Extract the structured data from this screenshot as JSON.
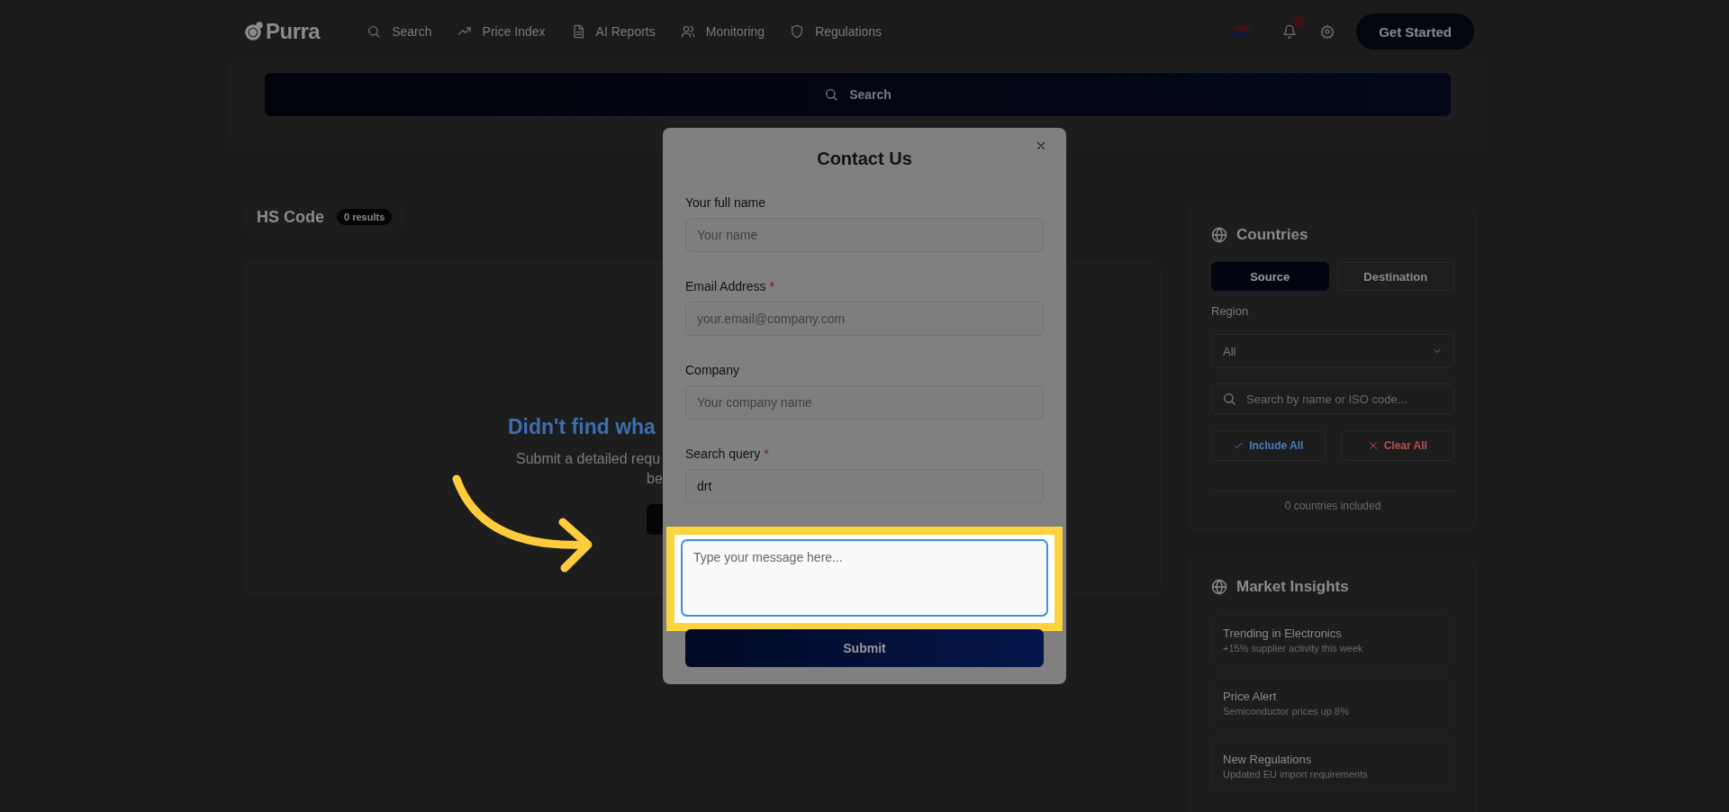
{
  "nav": {
    "logo": "Purra",
    "items": [
      {
        "kind": "search",
        "label": "Search"
      },
      {
        "kind": "trend",
        "label": "Price Index"
      },
      {
        "kind": "doc",
        "label": "AI Reports"
      },
      {
        "kind": "users",
        "label": "Monitoring"
      },
      {
        "kind": "shield",
        "label": "Regulations"
      }
    ],
    "cta": "Get Started"
  },
  "search_bar": {
    "label": "Search"
  },
  "hs_panel": {
    "title": "HS Code",
    "badge": "0 results"
  },
  "empty_state": {
    "heading": "Didn't find wha",
    "text": "Submit a detailed requ",
    "text_2": "be"
  },
  "countries": {
    "title": "Countries",
    "tabs": [
      {
        "label": "Source",
        "selected": true
      },
      {
        "label": "Destination",
        "selected": false
      }
    ],
    "region_label": "Region",
    "region_value": "All",
    "search_placeholder": "Search by name or ISO code...",
    "include_all": "Include All",
    "clear_all": "Clear All",
    "count": "0 countries included"
  },
  "market_insights": {
    "title": "Market Insights",
    "items": [
      {
        "title": "Trending in Electronics",
        "text": "+15% supplier activity this week",
        "color": "#1b2430"
      },
      {
        "title": "Price Alert",
        "text": "Semiconductor prices up 8%",
        "color": "#1c2129"
      },
      {
        "title": "New Regulations",
        "text": "Updated EU import requirements",
        "color": "#25231c"
      }
    ]
  },
  "modal": {
    "title": "Contact Us",
    "fields": [
      {
        "kind": "input",
        "label": "Your full name",
        "placeholder": "Your name"
      },
      {
        "kind": "input",
        "label": "Email Address",
        "required_mark": "*",
        "placeholder": "your.email@company.com"
      },
      {
        "kind": "input",
        "label": "Company",
        "placeholder": "Your company name"
      },
      {
        "kind": "input",
        "label": "Search query",
        "required_mark": "*",
        "value": "drt"
      },
      {
        "kind": "textarea",
        "placeholder": "Type your message here...",
        "highlighted": true
      }
    ],
    "submit": "Submit"
  }
}
